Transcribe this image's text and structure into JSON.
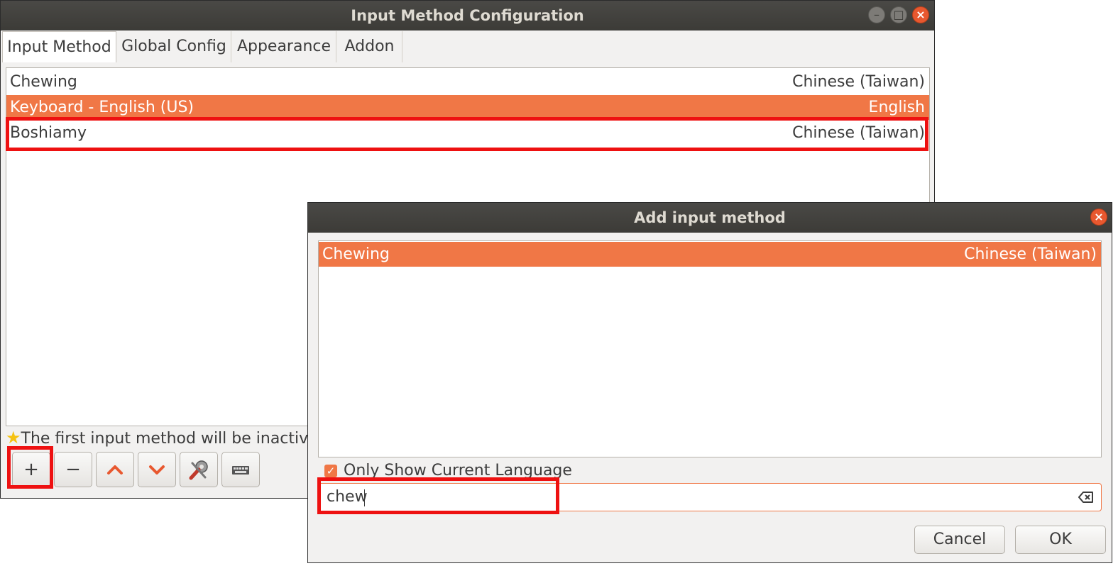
{
  "main_window": {
    "title": "Input Method Configuration",
    "tabs": [
      {
        "label": "Input Method",
        "active": true
      },
      {
        "label": "Global Config",
        "active": false
      },
      {
        "label": "Appearance",
        "active": false
      },
      {
        "label": "Addon",
        "active": false
      }
    ],
    "input_methods": [
      {
        "name": "Chewing",
        "language": "Chinese (Taiwan)",
        "selected": false
      },
      {
        "name": "Keyboard - English (US)",
        "language": "English",
        "selected": true
      },
      {
        "name": "Boshiamy",
        "language": "Chinese (Taiwan)",
        "selected": false
      }
    ],
    "hint_text": "The first input method will be inactive s",
    "toolbar": {
      "add_label": "+",
      "remove_label": "−"
    }
  },
  "dialog": {
    "title": "Add input method",
    "list": [
      {
        "name": "Chewing",
        "language": "Chinese (Taiwan)",
        "selected": true
      }
    ],
    "only_current_language": {
      "label": "Only Show Current Language",
      "checked": true
    },
    "search": {
      "value": "chew"
    },
    "cancel_label": "Cancel",
    "ok_label": "OK"
  },
  "colors": {
    "accent": "#f07746",
    "highlight_box": "#ee1111",
    "titlebar": "#3c3b37"
  }
}
